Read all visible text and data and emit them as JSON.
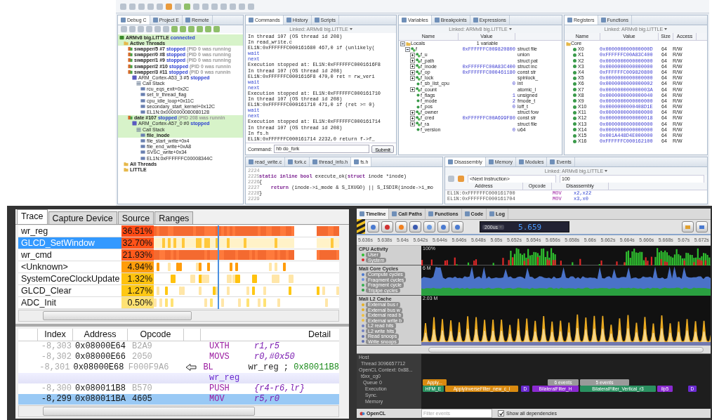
{
  "ide": {
    "debug_panel": {
      "tabs": [
        {
          "label": "Debug C",
          "selected": true
        },
        {
          "label": "Project E",
          "selected": false
        },
        {
          "label": "Remote",
          "selected": false
        }
      ],
      "tree": [
        {
          "kind": "target",
          "label": "ARMv8 big.LITTLE",
          "status": "connected",
          "highlighted": true,
          "children": [
            {
              "kind": "folder",
              "label": "Active Threads",
              "highlighted": true,
              "children": [
                {
                  "kind": "thread",
                  "label": "swapper/5 #7",
                  "status": "stopped",
                  "note": "(PID 0 was running",
                  "highlighted": false
                },
                {
                  "kind": "thread",
                  "label": "swapper/0 #8",
                  "status": "stopped",
                  "note": "(PID 0 was running",
                  "highlighted": false
                },
                {
                  "kind": "thread",
                  "label": "swapper/1 #9",
                  "status": "stopped",
                  "note": "(PID 0 was running",
                  "highlighted": false
                },
                {
                  "kind": "thread",
                  "label": "swapper/2 #10",
                  "status": "stopped",
                  "note": "(PID 0 was runnin",
                  "highlighted": false
                },
                {
                  "kind": "thread",
                  "label": "swapper/3 #11",
                  "status": "stopped",
                  "note": "(PID 0 was runnin",
                  "highlighted": false,
                  "children": [
                    {
                      "kind": "core",
                      "label": "ARM_Cortex-A53_3 #5",
                      "status": "stopped",
                      "highlighted": false,
                      "children": [
                        {
                          "kind": "stack",
                          "label": "Call Stack",
                          "highlighted": false,
                          "children": [
                            {
                              "kind": "frame",
                              "label": "rcu_eqs_exit+0x2C",
                              "highlighted": false
                            },
                            {
                              "kind": "frame",
                              "label": "set_tr_thread_flag",
                              "highlighted": false
                            },
                            {
                              "kind": "frame",
                              "label": "cpu_idle_loop+0x11C",
                              "highlighted": false
                            },
                            {
                              "kind": "frame",
                              "label": "secondary_start_kernel+0x12C",
                              "highlighted": false
                            },
                            {
                              "kind": "frame",
                              "label": "EL1N:0x0000000080080128",
                              "highlighted": false
                            }
                          ]
                        }
                      ]
                    }
                  ]
                },
                {
                  "kind": "thread",
                  "label": "date #107",
                  "status": "stopped",
                  "note": "(PID 208 was runnin",
                  "highlighted": true,
                  "children": [
                    {
                      "kind": "core",
                      "label": "ARM_Cortex-A57_0 #0",
                      "status": "stopped",
                      "highlighted": true,
                      "children": [
                        {
                          "kind": "stack",
                          "label": "Call Stack",
                          "highlighted": true,
                          "children": [
                            {
                              "kind": "frame",
                              "label": "file_inode",
                              "highlighted": true
                            },
                            {
                              "kind": "frame",
                              "label": "file_start_write+0x4",
                              "highlighted": false
                            },
                            {
                              "kind": "frame",
                              "label": "file_end_write+0xA8",
                              "highlighted": false
                            },
                            {
                              "kind": "frame",
                              "label": "SVSC_write+0x34",
                              "highlighted": false
                            },
                            {
                              "kind": "frame",
                              "label": "EL1N:0xFFFFFFC00008344C",
                              "highlighted": false
                            }
                          ]
                        }
                      ]
                    }
                  ]
                }
              ]
            },
            {
              "kind": "folder",
              "label": "All Threads",
              "highlighted": false
            },
            {
              "kind": "folder",
              "label": "LITTLE",
              "highlighted": false
            }
          ]
        }
      ]
    },
    "commands_panel": {
      "tabs": [
        {
          "label": "Commands",
          "selected": true
        },
        {
          "label": "History",
          "selected": false
        },
        {
          "label": "Scripts",
          "selected": false
        }
      ],
      "linked": "Linked: ARMv8 big.LITTLE",
      "lines": [
        {
          "kind": "output",
          "text": "In thread 107 (OS thread id 208)"
        },
        {
          "kind": "output",
          "text": "In read_write.c"
        },
        {
          "kind": "output",
          "text": "EL1N:0xFFFFFFC000161680   467,0   if (unlikely("
        },
        {
          "kind": "input",
          "text": "wait"
        },
        {
          "kind": "input",
          "text": "next"
        },
        {
          "kind": "output",
          "text": "Execution stopped at: EL1N:0xFFFFFFC0001616F8"
        },
        {
          "kind": "output",
          "text": "In thread 107 (OS thread id 208)"
        },
        {
          "kind": "output",
          "text": "EL1N:0xFFFFFFC0001616F8   470,0   ret = rw_veri"
        },
        {
          "kind": "input",
          "text": "wait"
        },
        {
          "kind": "input",
          "text": "next"
        },
        {
          "kind": "output",
          "text": "Execution stopped at: EL1N:0xFFFFFFC000161710"
        },
        {
          "kind": "output",
          "text": "In thread 107 (OS thread id 208)"
        },
        {
          "kind": "output",
          "text": "EL1N:0xFFFFFFC000161710   471,0   if (ret >= 0)"
        },
        {
          "kind": "input",
          "text": "wait"
        },
        {
          "kind": "input",
          "text": "next"
        },
        {
          "kind": "output",
          "text": "Execution stopped at: EL1N:0xFFFFFFC000161714"
        },
        {
          "kind": "output",
          "text": "In thread 107 (OS thread id 208)"
        },
        {
          "kind": "output",
          "text": "In fs.h"
        },
        {
          "kind": "output",
          "text": "EL1N:0xFFFFFFC000161714   2232,0   return f->f_"
        }
      ],
      "command_label": "Command:",
      "command_value": "hb do_fork",
      "submit": "Submit"
    },
    "variables_panel": {
      "tabs": [
        {
          "label": "Variables",
          "selected": true
        },
        {
          "label": "Breakpoints",
          "selected": false
        },
        {
          "label": "Expressions",
          "selected": false
        }
      ],
      "linked": "Linked: ARMv8 big.LITTLE",
      "columns": [
        "Name",
        "Value"
      ],
      "rows": [
        {
          "name": "Locals",
          "value": "1 variable",
          "expanded": true,
          "kind": "folder",
          "children": [
            {
              "name": "f",
              "value": "0xFFFFFFC009820800",
              "type": "struct file",
              "expanded": true,
              "kind": "struct",
              "children": [
                {
                  "name": "f_u",
                  "type": "union",
                  "expanded": false,
                  "kind": "struct"
                },
                {
                  "name": "f_path",
                  "type": "struct pat",
                  "expanded": false,
                  "kind": "struct"
                },
                {
                  "name": "f_inode",
                  "value": "0xFFFFFFC00A83C400",
                  "type": "struct inc",
                  "expanded": false,
                  "kind": "struct"
                },
                {
                  "name": "f_op",
                  "value": "0xFFFFFFC000461180",
                  "type": "const str",
                  "expanded": false,
                  "kind": "struct"
                },
                {
                  "name": "f_lock",
                  "type": "spinlock_",
                  "expanded": false,
                  "kind": "struct"
                },
                {
                  "name": "f_sb_list_cpu",
                  "value": "0",
                  "type": "int",
                  "kind": "scalar"
                },
                {
                  "name": "f_count",
                  "type": "atomic_l",
                  "expanded": false,
                  "kind": "struct"
                },
                {
                  "name": "f_flags",
                  "value": "1",
                  "type": "unsigned",
                  "kind": "scalar"
                },
                {
                  "name": "f_mode",
                  "value": "2",
                  "type": "fmode_t",
                  "kind": "scalar"
                },
                {
                  "name": "f_pos",
                  "value": "0",
                  "type": "loff_t",
                  "kind": "scalar"
                },
                {
                  "name": "f_owner",
                  "type": "struct fow",
                  "expanded": false,
                  "kind": "struct"
                },
                {
                  "name": "f_cred",
                  "value": "0xFFFFFFC00A699F80",
                  "type": "const str",
                  "expanded": false,
                  "kind": "struct"
                },
                {
                  "name": "f_ra",
                  "type": "struct file",
                  "expanded": false,
                  "kind": "struct"
                },
                {
                  "name": "f_version",
                  "value": "0",
                  "type": "u64",
                  "kind": "scalar"
                }
              ]
            }
          ]
        }
      ]
    },
    "registers_panel": {
      "tabs": [
        {
          "label": "Registers",
          "selected": true
        },
        {
          "label": "Functions",
          "selected": false
        }
      ],
      "linked": "Linked: ARMv8 big.LITTLE",
      "columns": [
        "Name",
        "Value",
        "Size",
        "Access"
      ],
      "group": "Core",
      "rows": [
        {
          "name": "X0",
          "value": "0x000000000000000D",
          "size": "64",
          "access": "R/W"
        },
        {
          "name": "X1",
          "value": "0xFFFFFFC00A83C400",
          "size": "64",
          "access": "R/W"
        },
        {
          "name": "X2",
          "value": "0x0000000000000000",
          "size": "64",
          "access": "R/W"
        },
        {
          "name": "X3",
          "value": "0x0000000000000000",
          "size": "64",
          "access": "R/W"
        },
        {
          "name": "X4",
          "value": "0xFFFFFFC009820800",
          "size": "64",
          "access": "R/W"
        },
        {
          "name": "X5",
          "value": "0x0000000000000000",
          "size": "64",
          "access": "R/W"
        },
        {
          "name": "X6",
          "value": "0x0000000000000002",
          "size": "64",
          "access": "R/W"
        },
        {
          "name": "X7",
          "value": "0x000000000000003A",
          "size": "64",
          "access": "R/W"
        },
        {
          "name": "X8",
          "value": "0x0000000000000040",
          "size": "64",
          "access": "R/W"
        },
        {
          "name": "X9",
          "value": "0x0000000000000000",
          "size": "64",
          "access": "R/W"
        },
        {
          "name": "X10",
          "value": "0x0000000000408D1E",
          "size": "64",
          "access": "R/W"
        },
        {
          "name": "X11",
          "value": "0x0000000000000000",
          "size": "64",
          "access": "R/W"
        },
        {
          "name": "X12",
          "value": "0x0000000000000018",
          "size": "64",
          "access": "R/W"
        },
        {
          "name": "X13",
          "value": "0x0000000000000000",
          "size": "64",
          "access": "R/W"
        },
        {
          "name": "X14",
          "value": "0x0000000000000000",
          "size": "64",
          "access": "R/W"
        },
        {
          "name": "X15",
          "value": "0x001A448D4E000000",
          "size": "64",
          "access": "R/W"
        },
        {
          "name": "X16",
          "value": "0xFFFFFFC000162100",
          "size": "64",
          "access": "R/W"
        }
      ]
    },
    "editor_panel": {
      "tabs": [
        {
          "label": "read_write.c",
          "selected": false
        },
        {
          "label": "fork.c",
          "selected": false
        },
        {
          "label": "thread_info.h",
          "selected": false
        },
        {
          "label": "fs.h",
          "selected": true
        }
      ],
      "lines": [
        {
          "number": "2224"
        },
        {
          "number": "2225",
          "code": "**static inline bool** execute_ok(**struct** inode *inode)"
        },
        {
          "number": "2226",
          "code": "{"
        },
        {
          "number": "2227",
          "code": "    **return** (inode->i_mode & S_IXUGO) || S_ISDIR(inode->i_mo"
        },
        {
          "number": "2228",
          "code": "}"
        },
        {
          "number": "2229"
        }
      ]
    },
    "disassembly_panel": {
      "tabs": [
        {
          "label": "Disassembly",
          "selected": true
        },
        {
          "label": "Memory",
          "selected": false
        },
        {
          "label": "Modules",
          "selected": false
        },
        {
          "label": "Events",
          "selected": false
        }
      ],
      "linked": "Linked: ARMv8 big.LITTLE",
      "location": "<Next Instruction>",
      "count": "100",
      "columns": [
        "Address",
        "Opcode",
        "Disassembly"
      ],
      "rows": [
        {
          "address": "EL1N:0xFFFFFFC000161700",
          "mnemonic": "MOV",
          "operands": "x2,x22"
        },
        {
          "address": "EL1N:0xFFFFFFC000161704",
          "mnemonic": "MOV",
          "operands": "x3,x0"
        }
      ]
    }
  },
  "trace_panel": {
    "tabs": [
      {
        "label": "Trace",
        "selected": true
      },
      {
        "label": "Capture Device",
        "selected": false
      },
      {
        "label": "Source",
        "selected": false
      },
      {
        "label": "Ranges",
        "selected": false
      }
    ],
    "functions": [
      {
        "name": "wr_reg",
        "percent": "36.51%",
        "color": "#ff4a14",
        "selected": false
      },
      {
        "name": "GLCD_SetWindow",
        "percent": "32.70%",
        "color": "#ff5218",
        "selected": true
      },
      {
        "name": "wr_cmd",
        "percent": "21.93%",
        "color": "#ff5a1c",
        "selected": false
      },
      {
        "name": "<Unknown>",
        "percent": "4.94%",
        "color": "#ff9c0a",
        "selected": false
      },
      {
        "name": "SystemCoreClockUpdate",
        "percent": "1.32%",
        "color": "#ffc20e",
        "selected": false
      },
      {
        "name": "GLCD_Clear",
        "percent": "1.27%",
        "color": "#ffc814",
        "selected": false
      },
      {
        "name": "ADC_Init",
        "percent": "0.50%",
        "color": "#ffe274",
        "selected": false
      }
    ],
    "columns": [
      "Index",
      "Address",
      "Opcode",
      "Detail"
    ],
    "rows": [
      {
        "kind": "instruction",
        "index": "-8,303",
        "address": "0x08000E64",
        "opcode": "B2A9",
        "mnemonic": "UXTH",
        "operands": "r1,r5",
        "selected": false,
        "branch": false
      },
      {
        "kind": "instruction",
        "index": "-8,302",
        "address": "0x08000E66",
        "opcode": "2050",
        "mnemonic": "MOVS",
        "operands": "r0,#0x50",
        "selected": false,
        "branch": false
      },
      {
        "kind": "instruction",
        "index": "-8,301",
        "address": "0x08000E68",
        "opcode": "F000F9A6",
        "mnemonic": "BL",
        "operands": "wr_reg ;",
        "comment": "0x80011B8",
        "selected": false,
        "branch": true
      },
      {
        "kind": "label",
        "text": "wr_reg"
      },
      {
        "kind": "instruction",
        "index": "-8,300",
        "address": "0x080011B8",
        "opcode": "B570",
        "mnemonic": "PUSH",
        "operands": "{r4-r6,lr}",
        "selected": false,
        "branch": false
      },
      {
        "kind": "instruction",
        "index": "-8,299",
        "address": "0x080011BA",
        "opcode": "4605",
        "mnemonic": "MOV",
        "operands": "r5,r0",
        "selected": true,
        "branch": false
      }
    ]
  },
  "timeline_panel": {
    "tabs": [
      {
        "label": "Timeline",
        "selected": true
      },
      {
        "label": "Call Paths",
        "selected": false
      },
      {
        "label": "Functions",
        "selected": false
      },
      {
        "label": "Code",
        "selected": false
      },
      {
        "label": "Log",
        "selected": false
      }
    ],
    "interval": "200us",
    "time": "5.659",
    "ruler": [
      "5.636s",
      "5.638s",
      "5.64s",
      "5.642s",
      "5.644s",
      "5.646s",
      "5.648s",
      "5.65s",
      "5.652s",
      "5.654s",
      "5.656s",
      "5.658s",
      "5.66s",
      "5.662s",
      "5.664s",
      "5.666s",
      "5.668s",
      "5.67s",
      "5.672s"
    ],
    "tracks": [
      {
        "kind": "bars",
        "title": "CPU Activity",
        "scale": "100%",
        "legend": [
          {
            "label": "User",
            "color": "#2fbf2f"
          },
          {
            "label": "System",
            "color": "#e02828"
          }
        ]
      },
      {
        "kind": "area",
        "title": "Mali Core Cycles",
        "scale": "6 M",
        "legend": [
          {
            "label": "Compute cycles",
            "color": "#4a78d0"
          },
          {
            "label": "Fragment cycles",
            "color": "#6a8fe0"
          },
          {
            "label": "Fragment cycle",
            "color": "#34b050"
          },
          {
            "label": "Tripipe cycles",
            "color": "#2aa040"
          }
        ]
      },
      {
        "kind": "spikes",
        "title": "Mali L2 Cache",
        "scale": "2.03 M",
        "legend": [
          {
            "label": "External bus r",
            "color": "#e8b020"
          },
          {
            "label": "External bus w",
            "color": "#e8b020"
          },
          {
            "label": "External read b",
            "color": "#f0c040"
          },
          {
            "label": "External write b",
            "color": "#f0c040"
          },
          {
            "label": "L2 read hits",
            "color": "#7080c0"
          },
          {
            "label": "L2 write hits",
            "color": "#7080c0"
          },
          {
            "label": "Read snoops",
            "color": "#6070b0"
          },
          {
            "label": "Write snoops",
            "color": "#6070b0"
          }
        ]
      }
    ],
    "lanes": [
      "Host",
      "Thread 3096657712",
      "OpenCL Context: 0x88...",
      "t6xx_cg0",
      "Queue 0",
      "Execution",
      "Sync.",
      "Memory"
    ],
    "events": [
      {
        "label": "Apply...",
        "color": "#d98a10"
      },
      {
        "label": "6 events",
        "color": "#9a9a9a"
      },
      {
        "label": "5 events",
        "color": "#9a9a9a"
      },
      {
        "label": "HFM_E",
        "color": "#2a9060"
      },
      {
        "label": "ApplyInverseFilter_new_c_i",
        "color": "#d98a10"
      },
      {
        "label": "D",
        "color": "#6a2ad0"
      },
      {
        "label": "BilateralFilter_H",
        "color": "#8a2ad0"
      },
      {
        "label": "BilateralFilter_Vertical_r3",
        "color": "#2a9060"
      },
      {
        "label": "ilp5",
        "color": "#8a2ad0"
      },
      {
        "label": "D",
        "color": "#6a2ad0"
      }
    ],
    "api": "OpenCL",
    "filter_placeholder": "Filter events",
    "show_dependencies": {
      "label": "Show all dependencies",
      "checked": true
    }
  }
}
